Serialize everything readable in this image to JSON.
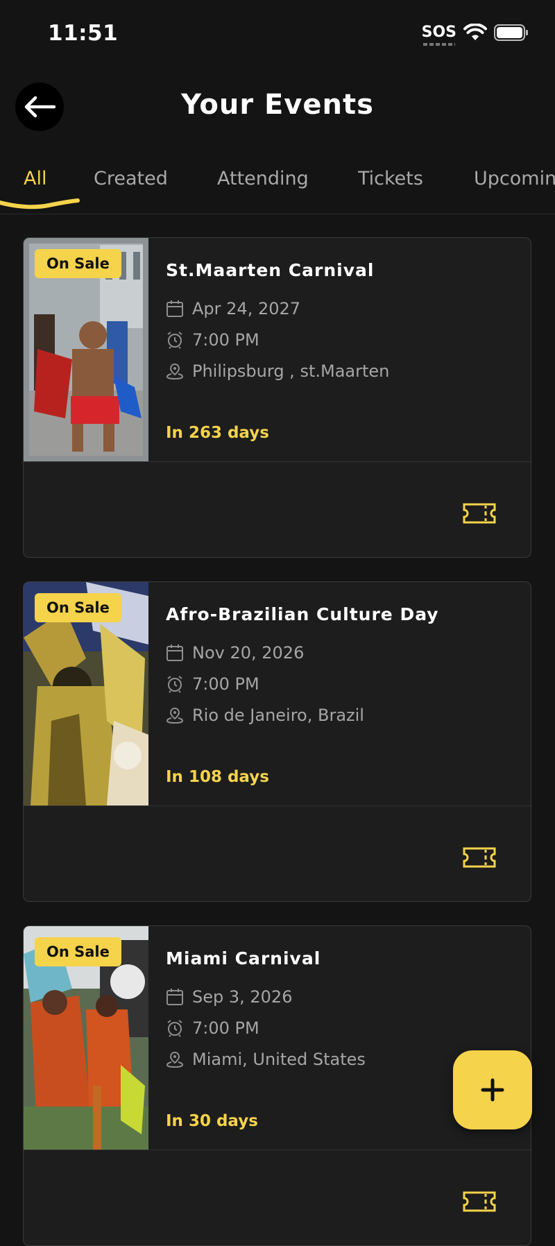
{
  "status_bar": {
    "time": "11:51",
    "sos": "SOS"
  },
  "header": {
    "title": "Your Events"
  },
  "tabs": [
    {
      "label": "All",
      "active": true
    },
    {
      "label": "Created",
      "active": false
    },
    {
      "label": "Attending",
      "active": false
    },
    {
      "label": "Tickets",
      "active": false
    },
    {
      "label": "Upcoming",
      "active": false
    }
  ],
  "events": [
    {
      "badge": "On Sale",
      "title": "St.Maarten Carnival",
      "date": "Apr 24, 2027",
      "time": "7:00 PM",
      "location": "Philipsburg , st.Maarten",
      "countdown": "In 263 days"
    },
    {
      "badge": "On Sale",
      "title": "Afro-Brazilian Culture Day",
      "date": "Nov 20, 2026",
      "time": "7:00 PM",
      "location": "Rio de Janeiro, Brazil",
      "countdown": "In 108 days"
    },
    {
      "badge": "On Sale",
      "title": "Miami Carnival",
      "date": "Sep 3, 2026",
      "time": "7:00 PM",
      "location": "Miami, United States",
      "countdown": "In 30 days"
    }
  ],
  "fab": {
    "icon": "plus-icon"
  },
  "colors": {
    "accent": "#f5d34b",
    "background": "#141414",
    "card": "#1d1d1d"
  }
}
